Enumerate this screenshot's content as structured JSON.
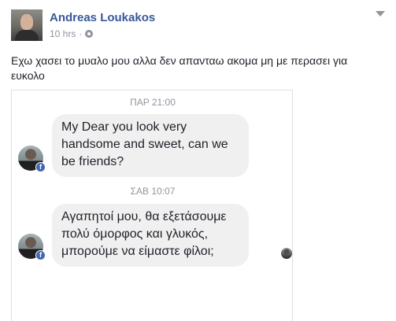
{
  "post": {
    "author": "Andreas Loukakos",
    "time": "10 hrs",
    "separator": "·",
    "text": "Εχω χασει το μυαλο μου αλλα δεν απανταω ακομα μη με περασει για ευκολο"
  },
  "conversation": {
    "messages": [
      {
        "date": "ΠΑΡ 21:00",
        "text": "My Dear you look very handsome and sweet, can we be friends?"
      },
      {
        "date": "ΣΑΒ 10:07",
        "text": "Αγαπητοί μου, θα εξετάσουμε πολύ όμορφος και γλυκός, μπορούμε να είμαστε φίλοι;"
      }
    ],
    "badge_icon": "facebook-icon",
    "badge_glyph": "f"
  },
  "icons": {
    "privacy": "globe-icon",
    "menu": "chevron-down-icon"
  },
  "colors": {
    "author": "#365899",
    "meta": "#90949c",
    "bubble": "#f1f0f0",
    "badge": "#4267b2"
  }
}
